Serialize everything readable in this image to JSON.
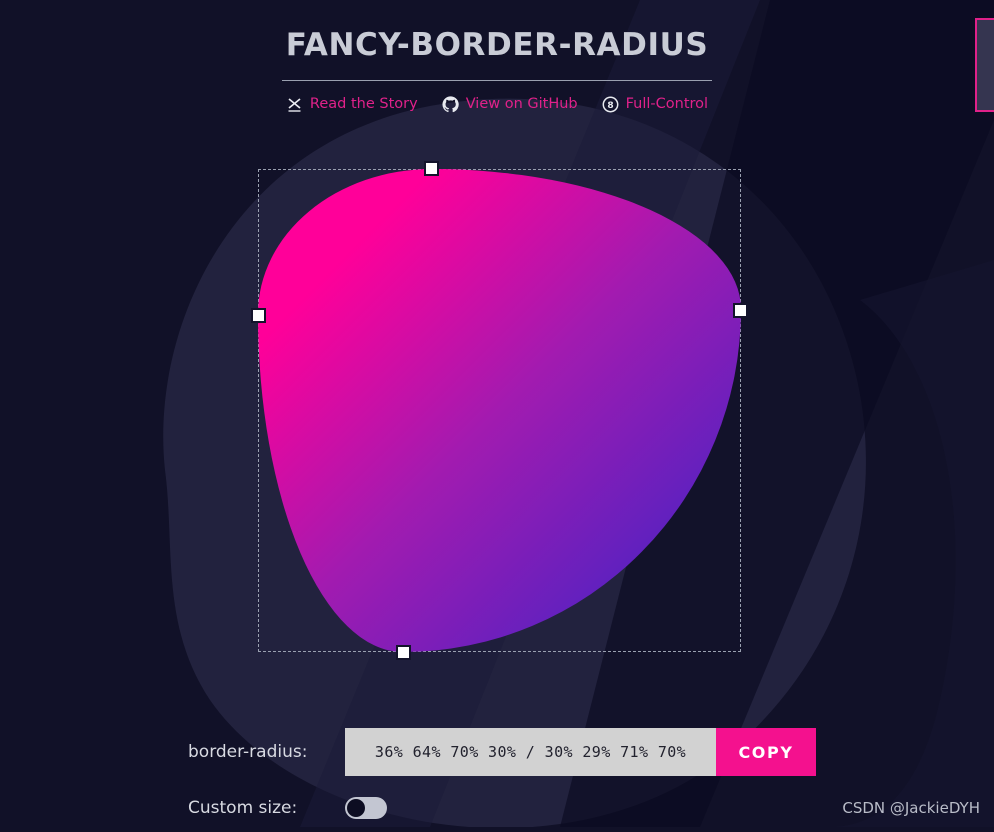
{
  "header": {
    "title": "FANCY-BORDER-RADIUS",
    "nav": [
      {
        "label": "Read the Story",
        "icon": "scissors-icon"
      },
      {
        "label": "View on GitHub",
        "icon": "github-icon"
      },
      {
        "label": "Full-Control",
        "icon": "eight-ball-icon"
      }
    ]
  },
  "editor": {
    "border_radius": "36% 64% 70% 30% / 30% 29% 71% 70%",
    "handles": [
      "handle-top",
      "handle-right",
      "handle-bottom",
      "handle-left"
    ]
  },
  "controls": {
    "radius_label": "border-radius:",
    "radius_value": "36% 64% 70% 30% / 30% 29% 71% 70%",
    "radius_placeholder": "36% 64% 70% 30% / 30% 29% 71% 70%",
    "copy_label": "COPY",
    "custom_size_label": "Custom size:",
    "custom_size_on": false
  },
  "watermark": "CSDN @JackieDYH",
  "colors": {
    "background": "#111128",
    "background_blob": "#262642",
    "accent_pink": "#e0218a",
    "copy_button": "#f4118e",
    "shape_gradient_start": "#ff0099",
    "shape_gradient_end": "#4f1fd0",
    "title_text": "#c9ccd6",
    "input_background": "#d2d2d2"
  }
}
